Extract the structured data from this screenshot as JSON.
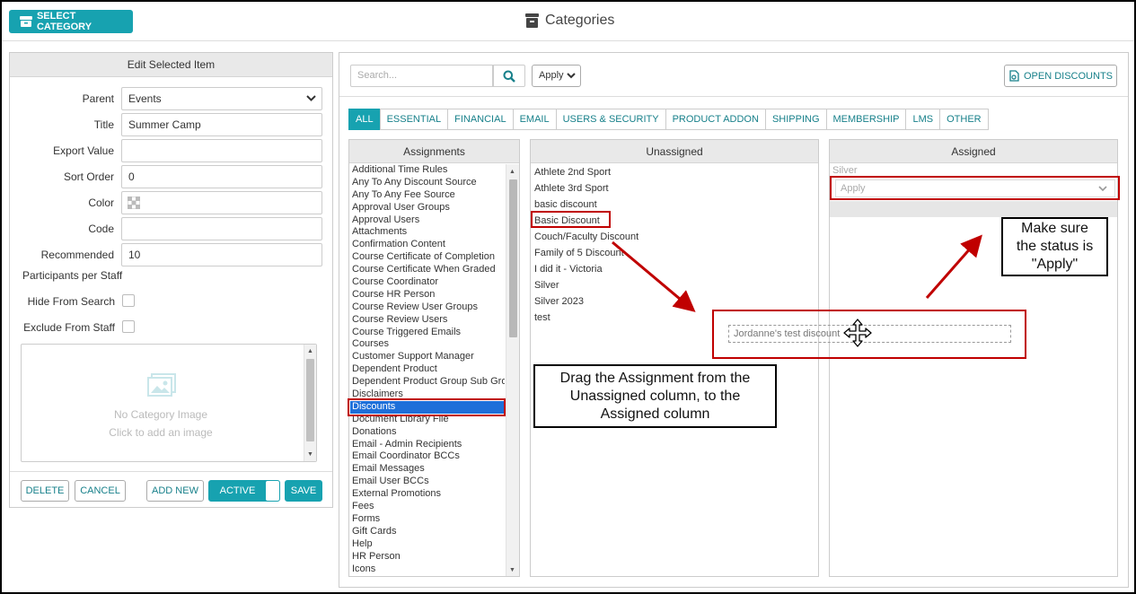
{
  "header": {
    "select_category": "SELECT CATEGORY",
    "title": "Categories"
  },
  "edit_panel": {
    "heading": "Edit Selected Item",
    "fields": [
      {
        "label": "Parent",
        "value": "Events",
        "type": "select"
      },
      {
        "label": "Title",
        "value": "Summer Camp",
        "type": "text"
      },
      {
        "label": "Export Value",
        "value": "",
        "type": "text"
      },
      {
        "label": "Sort Order",
        "value": "0",
        "type": "text"
      },
      {
        "label": "Color",
        "value": "",
        "type": "color"
      },
      {
        "label": "Code",
        "value": "",
        "type": "text"
      },
      {
        "label": "Recommended",
        "value": "10",
        "type": "text"
      }
    ],
    "participants_label": "Participants per Staff",
    "hide_from_search": "Hide From Search",
    "exclude_from_staff": "Exclude From Staff",
    "image_line1": "No Category Image",
    "image_line2": "Click to add an image",
    "buttons": {
      "delete": "DELETE",
      "cancel": "CANCEL",
      "add_new": "ADD NEW",
      "active": "ACTIVE",
      "save": "SAVE"
    }
  },
  "toolbar": {
    "search_placeholder": "Search...",
    "apply_select": "Apply",
    "open_discounts": "OPEN DISCOUNTS"
  },
  "tabs": [
    "ALL",
    "ESSENTIAL",
    "FINANCIAL",
    "EMAIL",
    "USERS & SECURITY",
    "PRODUCT ADDON",
    "SHIPPING",
    "MEMBERSHIP",
    "LMS",
    "OTHER"
  ],
  "columns": {
    "assignments": "Assignments",
    "unassigned": "Unassigned",
    "assigned": "Assigned"
  },
  "assignments": [
    "Additional Time Rules",
    "Any To Any Discount Source",
    "Any To Any Fee Source",
    "Approval User Groups",
    "Approval Users",
    "Attachments",
    "Confirmation Content",
    "Course Certificate of Completion",
    "Course Certificate When Graded",
    "Course Coordinator",
    "Course HR Person",
    "Course Review User Groups",
    "Course Review Users",
    "Course Triggered Emails",
    "Courses",
    "Customer Support Manager",
    "Dependent Product",
    "Dependent Product Group Sub Grou",
    "Disclaimers",
    "Discounts",
    "Document Library File",
    "Donations",
    "Email - Admin Recipients",
    "Email Coordinator BCCs",
    "Email Messages",
    "Email User BCCs",
    "External Promotions",
    "Fees",
    "Forms",
    "Gift Cards",
    "Help",
    "HR Person",
    "Icons"
  ],
  "selected_assignment": "Discounts",
  "unassigned": [
    "Athlete 2nd Sport",
    "Athlete 3rd Sport",
    "basic discount",
    "Basic Discount",
    "Couch/Faculty Discount",
    "Family of 5 Discount",
    "I did it - Victoria",
    "Silver",
    "Silver 2023",
    "test"
  ],
  "assigned": {
    "item": "Silver",
    "status": "Apply"
  },
  "dragging_item": "Jordanne's test discount",
  "callouts": {
    "drag": "Drag the Assignment from the Unassigned column, to the Assigned column",
    "status": "Make sure the status is \"Apply\""
  },
  "colors": {
    "accent": "#17a2b0",
    "annotation_red": "#c00000",
    "selection_blue": "#1e6fd9"
  }
}
